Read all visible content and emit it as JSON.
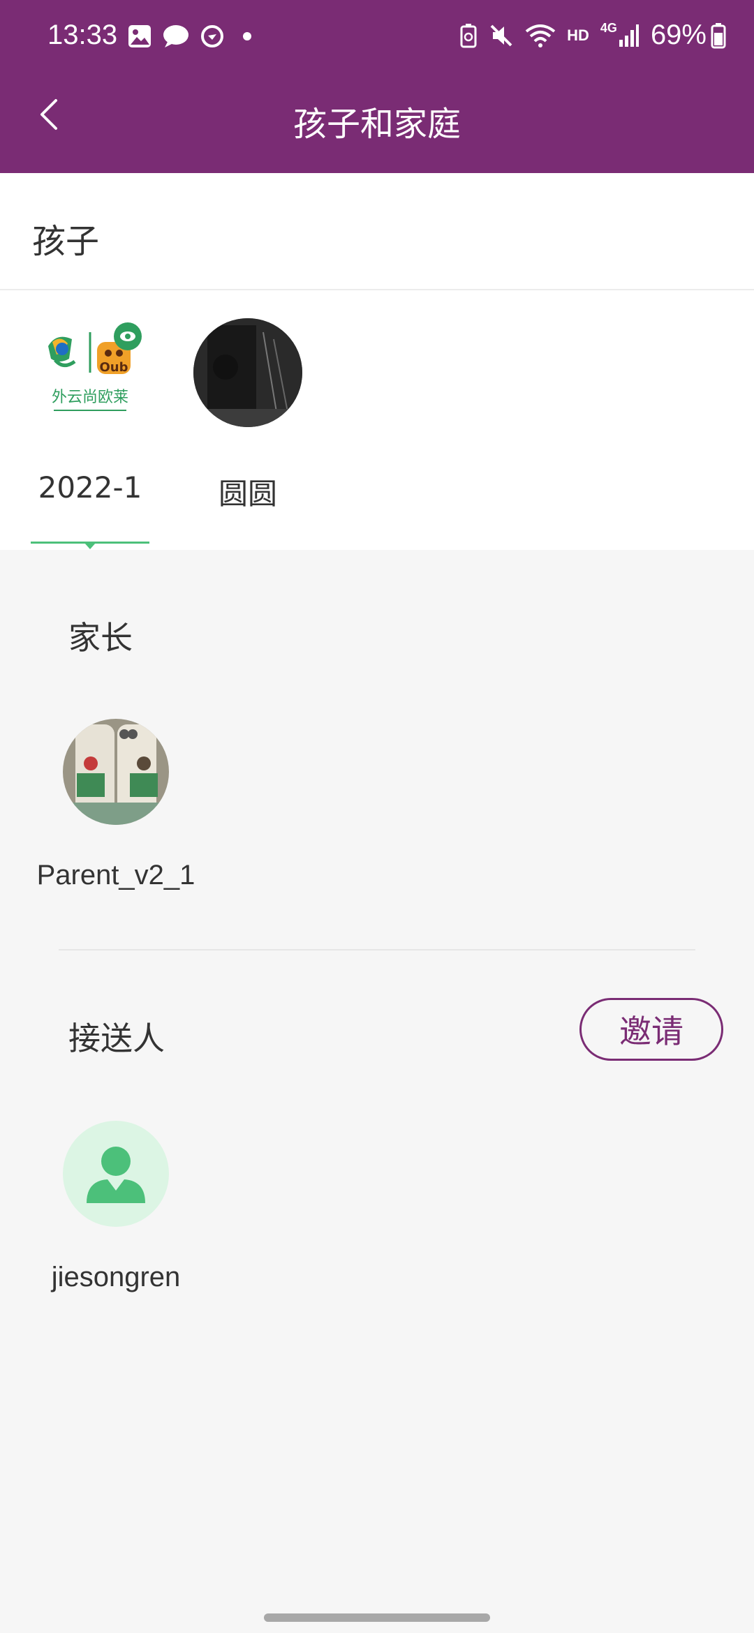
{
  "status_bar": {
    "time": "13:33",
    "network": "HD",
    "signal": "4G",
    "battery": "69%",
    "icons": [
      "gallery-icon",
      "chat-icon",
      "sync-icon",
      "dot-icon",
      "battery-saver-icon",
      "mute-icon",
      "wifi-icon",
      "signal-icon",
      "battery-icon"
    ]
  },
  "header": {
    "title": "孩子和家庭",
    "back_icon": "chevron-left-icon"
  },
  "children": {
    "section_title": "孩子",
    "items": [
      {
        "name": "2022-1",
        "selected": true,
        "logo_text": "外云尚欧莱"
      },
      {
        "name": "圆圆",
        "selected": false
      }
    ]
  },
  "parents": {
    "section_title": "家长",
    "items": [
      {
        "name": "Parent_v2_1"
      }
    ]
  },
  "pickup": {
    "section_title": "接送人",
    "invite_label": "邀请",
    "items": [
      {
        "name": "jiesongren",
        "avatar_icon": "person-icon"
      }
    ]
  },
  "colors": {
    "brand": "#7a2c74",
    "accent_green": "#4cc07a",
    "background": "#f6f6f6"
  }
}
